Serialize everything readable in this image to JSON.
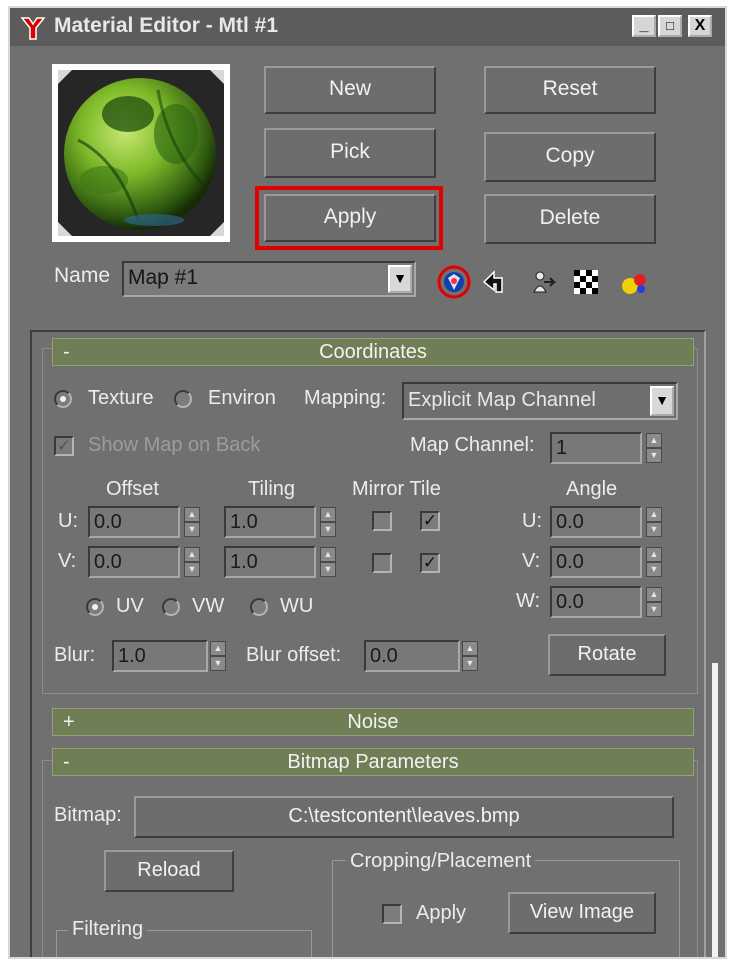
{
  "window": {
    "title": "Material Editor - Mtl #1",
    "controls": [
      "_",
      "□",
      "X"
    ]
  },
  "buttons": {
    "new": "New",
    "reset": "Reset",
    "pick": "Pick",
    "copy": "Copy",
    "apply": "Apply",
    "delete": "Delete"
  },
  "name_row": {
    "label": "Name",
    "value": "Map #1"
  },
  "toolbar_icons": [
    "material-map-navigator-icon",
    "go-to-parent-icon",
    "go-forward-to-sibling-icon",
    "show-background-checker-icon",
    "get-material-icon"
  ],
  "coordinates": {
    "header": "Coordinates",
    "collapse_sign": "-",
    "texture_label": "Texture",
    "environ_label": "Environ",
    "mapping_label": "Mapping:",
    "mapping_value": "Explicit Map Channel",
    "show_map_on_back": "Show Map on Back",
    "map_channel_label": "Map Channel:",
    "map_channel_value": "1",
    "offset_label": "Offset",
    "tiling_label": "Tiling",
    "mirror_tile_label": "Mirror Tile",
    "angle_label": "Angle",
    "u_label": "U:",
    "v_label": "V:",
    "w_label": "W:",
    "offset_u": "0.0",
    "offset_v": "0.0",
    "tiling_u": "1.0",
    "tiling_v": "1.0",
    "angle_u": "0.0",
    "angle_v": "0.0",
    "angle_w": "0.0",
    "uv_label": "UV",
    "vw_label": "VW",
    "wu_label": "WU",
    "blur_label": "Blur:",
    "blur_value": "1.0",
    "blur_offset_label": "Blur offset:",
    "blur_offset_value": "0.0",
    "rotate_label": "Rotate"
  },
  "noise": {
    "header": "Noise",
    "expand_sign": "+"
  },
  "bitmap_params": {
    "header": "Bitmap Parameters",
    "collapse_sign": "-",
    "bitmap_label": "Bitmap:",
    "bitmap_path": "C:\\testcontent\\leaves.bmp",
    "reload_label": "Reload",
    "cropping_label": "Cropping/Placement",
    "apply_label": "Apply",
    "view_image_label": "View Image",
    "filtering_label": "Filtering"
  },
  "colors": {
    "window_bg": "#707070",
    "rollout_header": "#6f7e55",
    "highlight": "#e00000"
  }
}
